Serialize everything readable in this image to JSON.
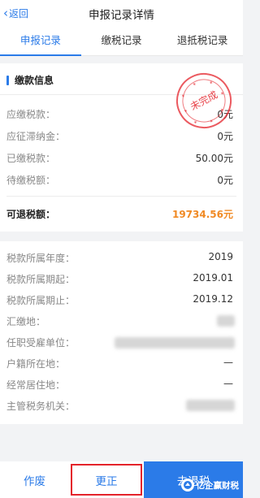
{
  "nav": {
    "back_label": "返回",
    "title": "申报记录详情"
  },
  "tabs": [
    {
      "label": "申报记录",
      "active": true
    },
    {
      "label": "缴税记录",
      "active": false
    },
    {
      "label": "退抵税记录",
      "active": false
    }
  ],
  "payment_section": {
    "title": "缴款信息",
    "stamp_text": "未完成",
    "rows": [
      {
        "label": "应缴税款：",
        "value": "0元"
      },
      {
        "label": "应征滞纳金：",
        "value": "0元"
      },
      {
        "label": "已缴税款：",
        "value": "50.00元"
      },
      {
        "label": "待缴税额：",
        "value": "0元"
      }
    ],
    "refund": {
      "label": "可退税额：",
      "value": "19734.56元"
    }
  },
  "detail_section": {
    "rows": [
      {
        "label": "税款所属年度：",
        "value": "2019"
      },
      {
        "label": "税款所属期起：",
        "value": "2019.01"
      },
      {
        "label": "税款所属期止：",
        "value": "2019.12"
      },
      {
        "label": "汇缴地：",
        "value": ""
      },
      {
        "label": "任职受雇单位：",
        "value": ""
      },
      {
        "label": "户籍所在地：",
        "value": "—"
      },
      {
        "label": "经常居住地：",
        "value": "—"
      },
      {
        "label": "主管税务机关：",
        "value": ""
      }
    ]
  },
  "bottom_bar": {
    "void_label": "作废",
    "correct_label": "更正",
    "refund_label": "去退税",
    "watermark": "亿企赢财税"
  },
  "colors": {
    "accent": "#2b7be8",
    "highlight": "#f08a24",
    "stamp": "#e4232b"
  }
}
